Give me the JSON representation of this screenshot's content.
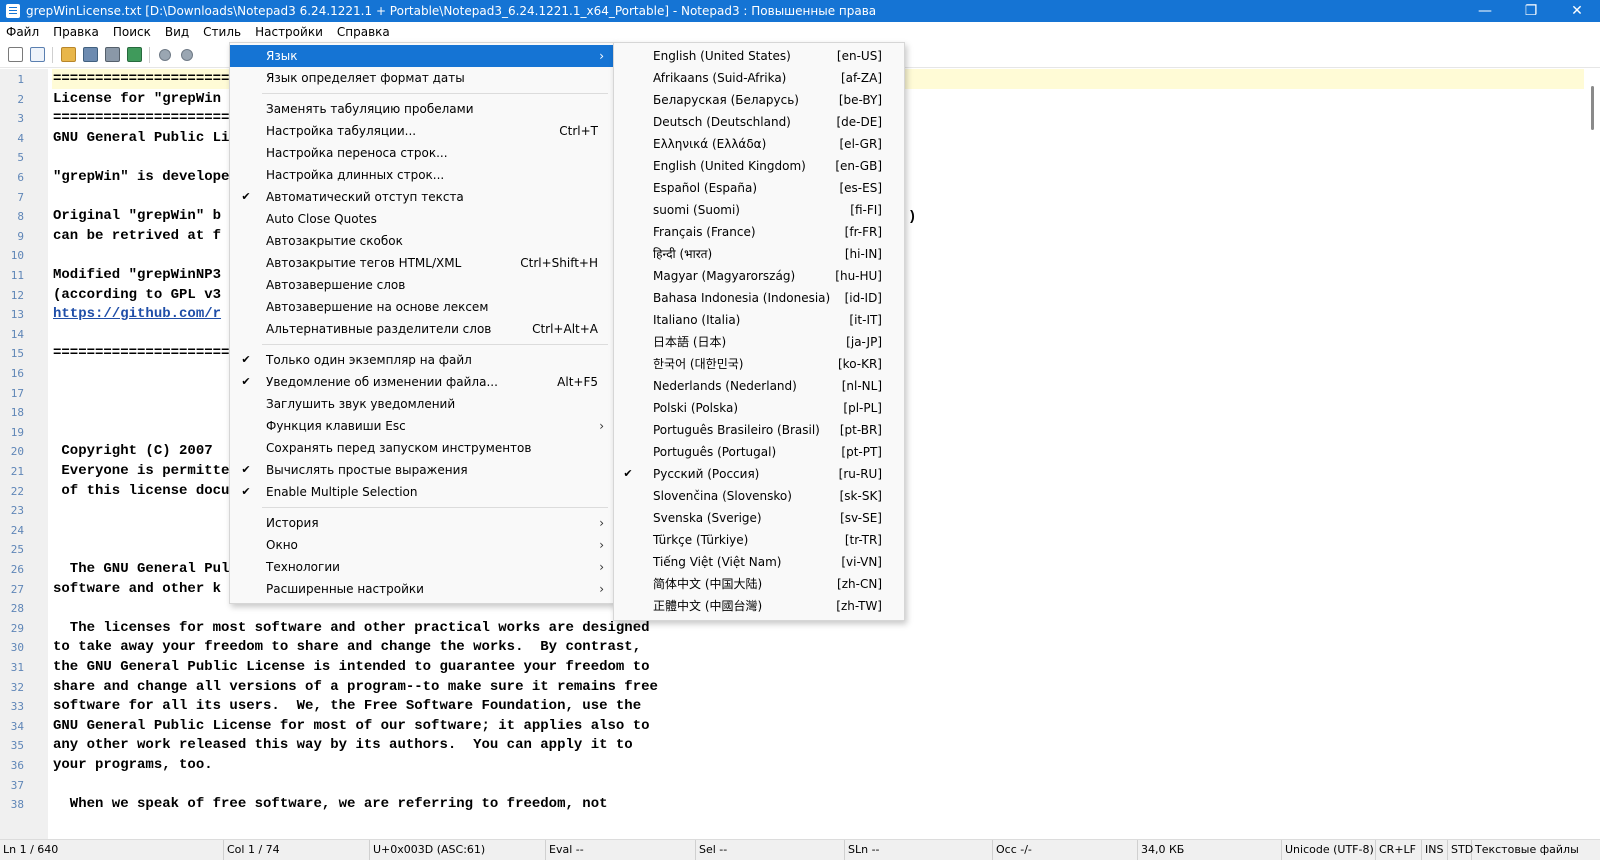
{
  "window": {
    "title": "grepWinLicense.txt [D:\\Downloads\\Notepad3 6.24.1221.1 + Portable\\Notepad3_6.24.1221.1_x64_Portable] - Notepad3 : Повышенные права",
    "buttons": {
      "minimize": "—",
      "maximize": "❐",
      "close": "✕"
    }
  },
  "menubar": [
    "Файл",
    "Правка",
    "Поиск",
    "Вид",
    "Стиль",
    "Настройки",
    "Справка"
  ],
  "toolbar_icons": [
    "new-file-icon",
    "new-window-icon",
    "open-folder-icon",
    "save-icon",
    "save-as-icon",
    "reload-icon",
    "undo-icon",
    "redo-icon"
  ],
  "editor": {
    "line_numbers": [
      "1",
      "2",
      "3",
      "4",
      "5",
      "6",
      "7",
      "8",
      "9",
      "10",
      "11",
      "12",
      "13",
      "14",
      "15",
      "16",
      "17",
      "18",
      "19",
      "20",
      "21",
      "22",
      "23",
      "24",
      "25",
      "26",
      "27",
      "28",
      "29",
      "30",
      "31",
      "32",
      "33",
      "34",
      "35",
      "36",
      "37",
      "38"
    ],
    "lines": [
      "=====================",
      "License for \"grepWin",
      "=====================",
      "GNU General Public Li",
      "",
      "\"grepWin\" is develope",
      "",
      "Original \"grepWin\" b",
      "can be retrived at f",
      "",
      "Modified \"grepWinNP3",
      "(according to GPL v3",
      "https://github.com/r",
      "",
      "=====================",
      "",
      "                     (",
      "",
      "",
      " Copyright (C) 2007 ",
      " Everyone is permitte",
      " of this license docu",
      "",
      "",
      "",
      "  The GNU General Pul",
      "software and other k",
      "",
      "  The licenses for most software and other practical works are designed",
      "to take away your freedom to share and change the works.  By contrast,",
      "the GNU General Public License is intended to guarantee your freedom to",
      "share and change all versions of a program--to make sure it remains free",
      "software for all its users.  We, the Free Software Foundation, use the",
      "GNU General Public License for most of our software; it applies also to",
      "any other work released this way by its authors.  You can apply it to",
      "your programs, too.",
      "",
      "  When we speak of free software, we are referring to freedom, not"
    ],
    "link_line_index": 12,
    "fragment": ")"
  },
  "settings_menu": {
    "items": [
      {
        "label": "Язык",
        "submenu": true,
        "highlighted": true
      },
      {
        "label": "Язык определяет формат даты"
      },
      {
        "separator": true
      },
      {
        "label": "Заменять табуляцию пробелами"
      },
      {
        "label": "Настройка табуляции...",
        "shortcut": "Ctrl+T"
      },
      {
        "label": "Настройка переноса строк..."
      },
      {
        "label": "Настройка длинных строк..."
      },
      {
        "label": "Автоматический отступ текста",
        "checked": true
      },
      {
        "label": "Auto Close Quotes"
      },
      {
        "label": "Автозакрытие скобок"
      },
      {
        "label": "Автозакрытие тегов HTML/XML",
        "shortcut": "Ctrl+Shift+H"
      },
      {
        "label": "Автозавершение слов"
      },
      {
        "label": "Автозавершение на основе лексем"
      },
      {
        "label": "Альтернативные разделители слов",
        "shortcut": "Ctrl+Alt+A"
      },
      {
        "separator": true
      },
      {
        "label": "Только один экземпляр на файл",
        "checked": true
      },
      {
        "label": "Уведомление об изменении файла...",
        "shortcut": "Alt+F5",
        "checked": true
      },
      {
        "label": "Заглушить звук уведомлений"
      },
      {
        "label": "Функция клавиши Esc",
        "submenu": true
      },
      {
        "label": "Сохранять перед запуском инструментов"
      },
      {
        "label": "Вычислять простые выражения",
        "checked": true
      },
      {
        "label": "Enable Multiple Selection",
        "checked": true
      },
      {
        "separator": true
      },
      {
        "label": "История",
        "submenu": true
      },
      {
        "label": "Окно",
        "submenu": true
      },
      {
        "label": "Технологии",
        "submenu": true
      },
      {
        "label": "Расширенные настройки",
        "submenu": true
      }
    ]
  },
  "language_menu": {
    "items": [
      {
        "name": "English (United States)",
        "code": "[en-US]"
      },
      {
        "name": "Afrikaans (Suid-Afrika)",
        "code": "[af-ZA]"
      },
      {
        "name": "Беларуская (Беларусь)",
        "code": "[be-BY]"
      },
      {
        "name": "Deutsch (Deutschland)",
        "code": "[de-DE]"
      },
      {
        "name": "Ελληνικά (Ελλάδα)",
        "code": "[el-GR]"
      },
      {
        "name": "English (United Kingdom)",
        "code": "[en-GB]"
      },
      {
        "name": "Español (España)",
        "code": "[es-ES]"
      },
      {
        "name": "suomi (Suomi)",
        "code": "[fi-FI]"
      },
      {
        "name": "Français (France)",
        "code": "[fr-FR]"
      },
      {
        "name": "हिन्दी (भारत)",
        "code": "[hi-IN]"
      },
      {
        "name": "Magyar (Magyarország)",
        "code": "[hu-HU]"
      },
      {
        "name": "Bahasa Indonesia (Indonesia)",
        "code": "[id-ID]"
      },
      {
        "name": "Italiano (Italia)",
        "code": "[it-IT]"
      },
      {
        "name": "日本語 (日本)",
        "code": "[ja-JP]"
      },
      {
        "name": "한국어 (대한민국)",
        "code": "[ko-KR]"
      },
      {
        "name": "Nederlands (Nederland)",
        "code": "[nl-NL]"
      },
      {
        "name": "Polski (Polska)",
        "code": "[pl-PL]"
      },
      {
        "name": "Português Brasileiro (Brasil)",
        "code": "[pt-BR]"
      },
      {
        "name": "Português (Portugal)",
        "code": "[pt-PT]"
      },
      {
        "name": "Русский (Россия)",
        "code": "[ru-RU]",
        "checked": true
      },
      {
        "name": "Slovenčina (Slovensko)",
        "code": "[sk-SK]"
      },
      {
        "name": "Svenska (Sverige)",
        "code": "[sv-SE]"
      },
      {
        "name": "Türkçe (Türkiye)",
        "code": "[tr-TR]"
      },
      {
        "name": "Tiếng Việt (Việt Nam)",
        "code": "[vi-VN]"
      },
      {
        "name": "简体中文 (中国大陆)",
        "code": "[zh-CN]"
      },
      {
        "name": "正體中文 (中國台灣)",
        "code": "[zh-TW]"
      }
    ]
  },
  "statusbar": [
    "Ln  1 / 640",
    "Col  1 / 74",
    "U+0x003D (ASC:61)",
    "Eval  --",
    "Sel  --",
    "SLn  --",
    "Occ  -/-",
    "34,0 КБ",
    "Unicode (UTF-8)",
    "CR+LF",
    "INS",
    "STD",
    "Текстовые файлы"
  ],
  "colors": {
    "accent": "#1574d4",
    "line_number": "#5f86b7",
    "current_line": "#fffbd6",
    "link": "#1f4ea8"
  }
}
